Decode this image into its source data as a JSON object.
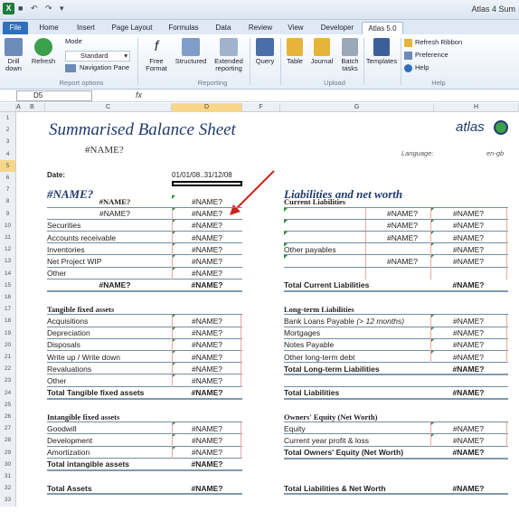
{
  "app": {
    "title": "Atlas 4 Sum",
    "namebox": "D5",
    "fx": "fx"
  },
  "tabs": [
    "File",
    "Home",
    "Insert",
    "Page Layout",
    "Formulas",
    "Data",
    "Review",
    "View",
    "Developer",
    "Atlas 5.0"
  ],
  "ribbon": {
    "drill": "Drill down",
    "refresh": "Refresh",
    "mode": "Mode",
    "standard": "Standard",
    "navpane": "Navigation Pane",
    "free": "Free Format",
    "structured": "Structured",
    "extended": "Extended reporting",
    "query": "Query",
    "table": "Table",
    "journal": "Journal",
    "batch": "Batch tasks",
    "templates": "Templates",
    "refresh_ribbon": "Refresh Ribbon",
    "preference": "Preference",
    "help": "Help",
    "groups": [
      "Report options",
      "Reporting",
      "Upload",
      "Help"
    ]
  },
  "columns": [
    "A",
    "B",
    "C",
    "D",
    "F",
    "G",
    "H"
  ],
  "rows": [
    "1",
    "2",
    "3",
    "4",
    "5",
    "6",
    "7",
    "8",
    "9",
    "10",
    "11",
    "12",
    "13",
    "14",
    "15",
    "16",
    "17",
    "18",
    "19",
    "20",
    "21",
    "22",
    "23",
    "24",
    "25",
    "26",
    "27",
    "28",
    "29",
    "30",
    "31",
    "32",
    "33"
  ],
  "sheet": {
    "title": "Summarised Balance Sheet",
    "name_err": "#NAME?",
    "language_label": "Language:",
    "language_value": "en-gb",
    "date_label": "Date:",
    "date_value": "01/01/08..31/12/08",
    "logo": "atlas",
    "left_header": "#NAME?",
    "right_header": "Liabilities and net worth",
    "current_liab": "Current Liabilities",
    "left_items": [
      "#NAME?",
      "#NAME?",
      "Securities",
      "Accounts receivable",
      "Inventories",
      "Net Project WIP",
      "Other",
      "#NAME?"
    ],
    "tangible": "Tangible fixed assets",
    "tangible_items": [
      "Acquisitions",
      "Depreciation",
      "Disposals",
      "Write up / Write down",
      "Revaluations",
      "Other"
    ],
    "total_tangible": "Total Tangible fixed assets",
    "intangible": "Intangible fixed assets",
    "intangible_items": [
      "Goodwill",
      "Development",
      "Amortization"
    ],
    "total_intangible": "Total intangible assets",
    "total_assets": "Total Assets",
    "right_cur_items": [
      "#NAME?",
      "#NAME?",
      "#NAME?",
      "Other payables",
      "#NAME?"
    ],
    "total_current_liab": "Total Current Liabilities",
    "longterm": "Long-term Liabilities",
    "longterm_items": [
      "Bank Loans Payable",
      "Mortgages",
      "Notes Payable",
      "Other long-term debt"
    ],
    "bank_note": "(> 12 months)",
    "total_longterm": "Total Long-term Liabilities",
    "total_liab": "Total Liabilities",
    "owners": "Owners' Equity (Net Worth)",
    "owners_items": [
      "Equity",
      "Current year profit & loss"
    ],
    "total_owners": "Total Owners' Equity (Net Worth)",
    "total_liab_net": "Total Liabilities & Net Worth",
    "value": "#NAME?"
  },
  "colors": {
    "accent": "#2e6fbe",
    "arrow": "#c8261e",
    "header_blue": "#1f3b70",
    "selected": "#f7d68a"
  }
}
